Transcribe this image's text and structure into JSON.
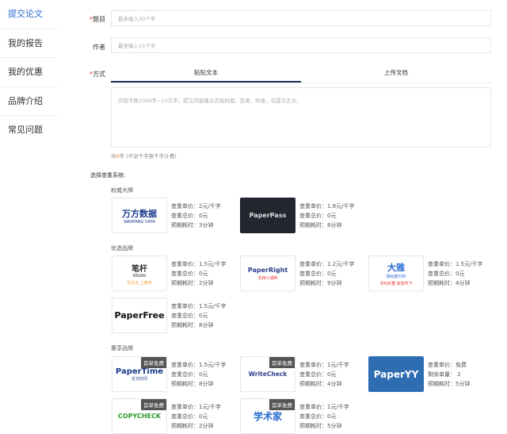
{
  "sidebar": {
    "items": [
      {
        "label": "提交论文"
      },
      {
        "label": "我的报告"
      },
      {
        "label": "我的优惠"
      },
      {
        "label": "品牌介绍"
      },
      {
        "label": "常见问题"
      }
    ]
  },
  "form": {
    "title_label": "题目",
    "title_placeholder": "最多输入30个字",
    "author_label": "作者",
    "author_placeholder": "最多输入15个字",
    "method_label": "方式",
    "required_mark": "*",
    "tabs": [
      {
        "label": "粘贴文本"
      },
      {
        "label": "上传文档"
      }
    ],
    "textarea_placeholder": "内容字数1000字~10万字。提交内容建议去除封面、目录、附录，仅提交正文。",
    "count_prefix": "共",
    "count_value": "0",
    "count_suffix": "字",
    "count_note": "(不足千字按千字计费)",
    "select_label": "选择查重系统:"
  },
  "groups": [
    {
      "title": "权威大牌",
      "cards": [
        {
          "logo": "万方数据",
          "logo_sub": "WANFANG DATA",
          "lines": [
            "查重单价：2元/千字",
            "查重总价：0元",
            "预期耗时：3分钟"
          ]
        },
        {
          "logo": "PaperPass",
          "lines": [
            "查重单价：1.8元/千字",
            "查重总价：0元",
            "预期耗时：8分钟"
          ]
        }
      ]
    },
    {
      "title": "优选品牌",
      "cards": [
        {
          "logo": "笔杆",
          "logo_sub": "BIGAN",
          "logo_tag": "写论文 上笔杆",
          "lines": [
            "查重单价：1.5元/千字",
            "查重总价：0元",
            "预期耗时：2分钟"
          ]
        },
        {
          "logo": "PaperRight",
          "logo_tag": "支持小语种",
          "lines": [
            "查重单价：1.2元/千字",
            "查重总价：0元",
            "预期耗时：9分钟"
          ]
        },
        {
          "logo": "大雅",
          "logo_sub": "相似度分析",
          "logo_tag": "书刊并重 双管齐下",
          "lines": [
            "查重单价：1.5元/千字",
            "查重总价：0元",
            "预期耗时：4分钟"
          ]
        },
        {
          "logo": "PaperFree",
          "lines": [
            "查重单价：1.5元/千字",
            "查重总价：0元",
            "预期耗时：8分钟"
          ]
        }
      ]
    },
    {
      "title": "惠享品牌",
      "badge": "首单免费",
      "cards": [
        {
          "logo": "PaperTime",
          "logo_sub": "论文时间",
          "lines": [
            "查重单价：1.5元/千字",
            "查重总价：0元",
            "预期耗时：8分钟"
          ]
        },
        {
          "logo": "WriteCheck",
          "lines": [
            "查重单价：1元/千字",
            "查重总价：0元",
            "预期耗时：4分钟"
          ]
        },
        {
          "logo": "PaperYY",
          "lines": [
            "查重单价：免费",
            "剩余单量： 2",
            "预期耗时：5分钟"
          ]
        },
        {
          "logo": "COPYCHECK",
          "lines": [
            "查重单价：1元/千字",
            "查重总价：0元",
            "预期耗时：2分钟"
          ]
        },
        {
          "logo": "学术家",
          "lines": [
            "查重单价：1元/千字",
            "查重总价：0元",
            "预期耗时：5分钟"
          ]
        }
      ]
    }
  ]
}
